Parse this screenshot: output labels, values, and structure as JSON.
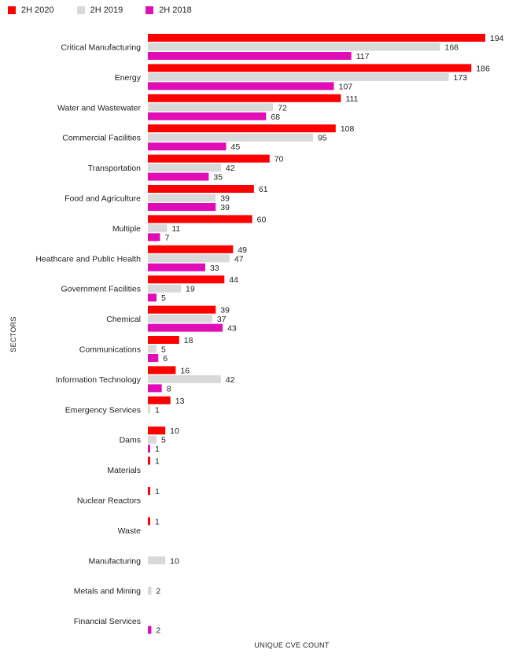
{
  "chart_data": {
    "type": "bar",
    "orientation": "horizontal",
    "title": "",
    "xlabel": "UNIQUE CVE COUNT",
    "ylabel": "SECTORS",
    "legend_position": "top-left",
    "grid": false,
    "xlim": [
      0,
      194
    ],
    "categories": [
      "Critical Manufacturing",
      "Energy",
      "Water and Wastewater",
      "Commercial Facilities",
      "Transportation",
      "Food and Agriculture",
      "Multiple",
      "Heathcare and Public Health",
      "Government Facilities",
      "Chemical",
      "Communications",
      "Information Technology",
      "Emergency Services",
      "Dams",
      "Materials",
      "Nuclear Reactors",
      "Waste",
      "Manufacturing",
      "Metals and Mining",
      "Financial Services"
    ],
    "series": [
      {
        "name": "2H 2020",
        "color": "#ff0000",
        "values": [
          194,
          186,
          111,
          108,
          70,
          61,
          60,
          49,
          44,
          39,
          18,
          16,
          13,
          10,
          1,
          1,
          1,
          null,
          null,
          null
        ]
      },
      {
        "name": "2H 2019",
        "color": "#d9d9d9",
        "values": [
          168,
          173,
          72,
          95,
          42,
          39,
          11,
          47,
          19,
          37,
          5,
          42,
          1,
          5,
          null,
          null,
          null,
          10,
          2,
          null
        ]
      },
      {
        "name": "2H 2018",
        "color": "#e00db7",
        "values": [
          117,
          107,
          68,
          45,
          35,
          39,
          7,
          33,
          5,
          43,
          6,
          8,
          null,
          1,
          null,
          null,
          null,
          null,
          null,
          2
        ]
      }
    ]
  }
}
